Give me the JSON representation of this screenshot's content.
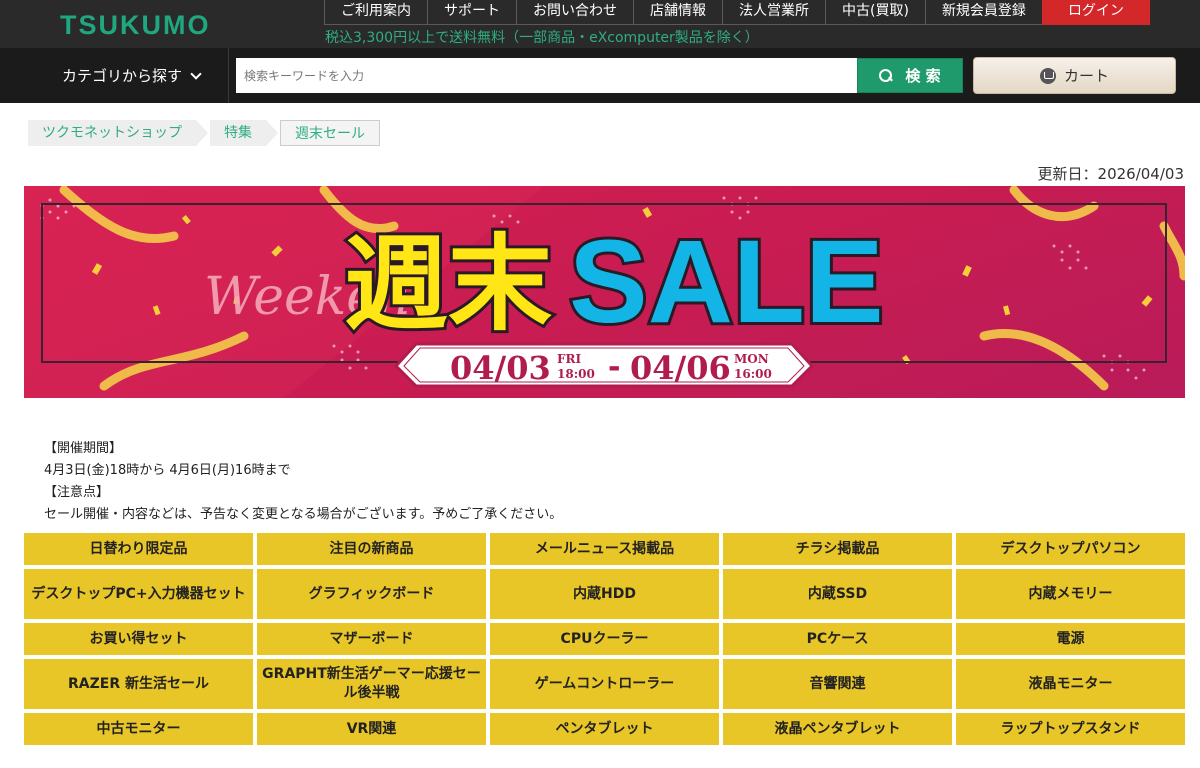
{
  "header": {
    "logo": "TSUKUMO",
    "nav": [
      "ご利用案内",
      "サポート",
      "お問い合わせ",
      "店舗情報",
      "法人営業所",
      "中古(買取)",
      "新規会員登録"
    ],
    "login": "ログイン",
    "notice": "税込3,300円以上で送料無料（一部商品・eXcomputer製品を除く）"
  },
  "search": {
    "category_label": "カテゴリから探す",
    "placeholder": "検索キーワードを入力",
    "button": "検 索",
    "cart": "カート"
  },
  "breadcrumb": [
    "ツクモネットショップ",
    "特集",
    "週末セール"
  ],
  "updated": "更新日：2026/04/03",
  "banner": {
    "script_text": "Weekend",
    "title_jp": "週末",
    "title_en": "SALE",
    "start_date": "04/03",
    "start_day": "FRI",
    "start_time": "18:00",
    "end_date": "04/06",
    "end_day": "MON",
    "end_time": "16:00"
  },
  "info": {
    "period_heading": "【開催期間】",
    "period_text": "4月3日(金)18時から 4月6日(月)16時まで",
    "notes_heading": "【注意点】",
    "notes_text": "セール開催・内容などは、予告なく変更となる場合がございます。予めご了承ください。"
  },
  "categories": [
    "日替わり限定品",
    "注目の新商品",
    "メールニュース掲載品",
    "チラシ掲載品",
    "デスクトップパソコン",
    "デスクトップPC+入力機器セット",
    "グラフィックボード",
    "内蔵HDD",
    "内蔵SSD",
    "内蔵メモリー",
    "お買い得セット",
    "マザーボード",
    "CPUクーラー",
    "PCケース",
    "電源",
    "RAZER 新生活セール",
    "GRAPHT新生活ゲーマー応援セール後半戦",
    "ゲームコントローラー",
    "音響関連",
    "液晶モニター",
    "中古モニター",
    "VR関連",
    "ペンタブレット",
    "液晶ペンタブレット",
    "ラップトップスタンド"
  ]
}
